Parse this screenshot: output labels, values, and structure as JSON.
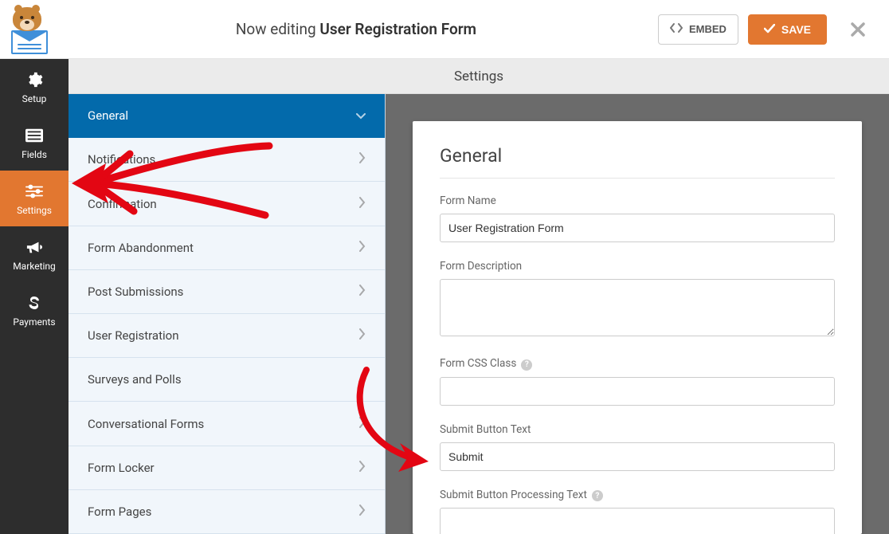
{
  "header": {
    "editing_prefix": "Now editing",
    "form_title": "User Registration Form",
    "embed_label": "EMBED",
    "save_label": "SAVE"
  },
  "rail": {
    "items": [
      {
        "id": "setup",
        "label": "Setup",
        "icon": "gear"
      },
      {
        "id": "fields",
        "label": "Fields",
        "icon": "list"
      },
      {
        "id": "settings",
        "label": "Settings",
        "icon": "sliders",
        "active": true
      },
      {
        "id": "marketing",
        "label": "Marketing",
        "icon": "bullhorn"
      },
      {
        "id": "payments",
        "label": "Payments",
        "icon": "dollar"
      }
    ]
  },
  "panel_title": "Settings",
  "subnav": {
    "items": [
      {
        "label": "General",
        "active": true,
        "expand": "down"
      },
      {
        "label": "Notifications",
        "expand": "right"
      },
      {
        "label": "Confirmation",
        "expand": "right"
      },
      {
        "label": "Form Abandonment",
        "expand": "right"
      },
      {
        "label": "Post Submissions",
        "expand": "right"
      },
      {
        "label": "User Registration",
        "expand": "right"
      },
      {
        "label": "Surveys and Polls"
      },
      {
        "label": "Conversational Forms",
        "expand": "right"
      },
      {
        "label": "Form Locker",
        "expand": "right"
      },
      {
        "label": "Form Pages",
        "expand": "right"
      }
    ]
  },
  "content": {
    "heading": "General",
    "fields": {
      "form_name": {
        "label": "Form Name",
        "value": "User Registration Form"
      },
      "form_description": {
        "label": "Form Description",
        "value": ""
      },
      "form_css_class": {
        "label": "Form CSS Class",
        "value": "",
        "help": true
      },
      "submit_text": {
        "label": "Submit Button Text",
        "value": "Submit"
      },
      "submit_processing": {
        "label": "Submit Button Processing Text",
        "value": "",
        "help": true
      }
    }
  }
}
